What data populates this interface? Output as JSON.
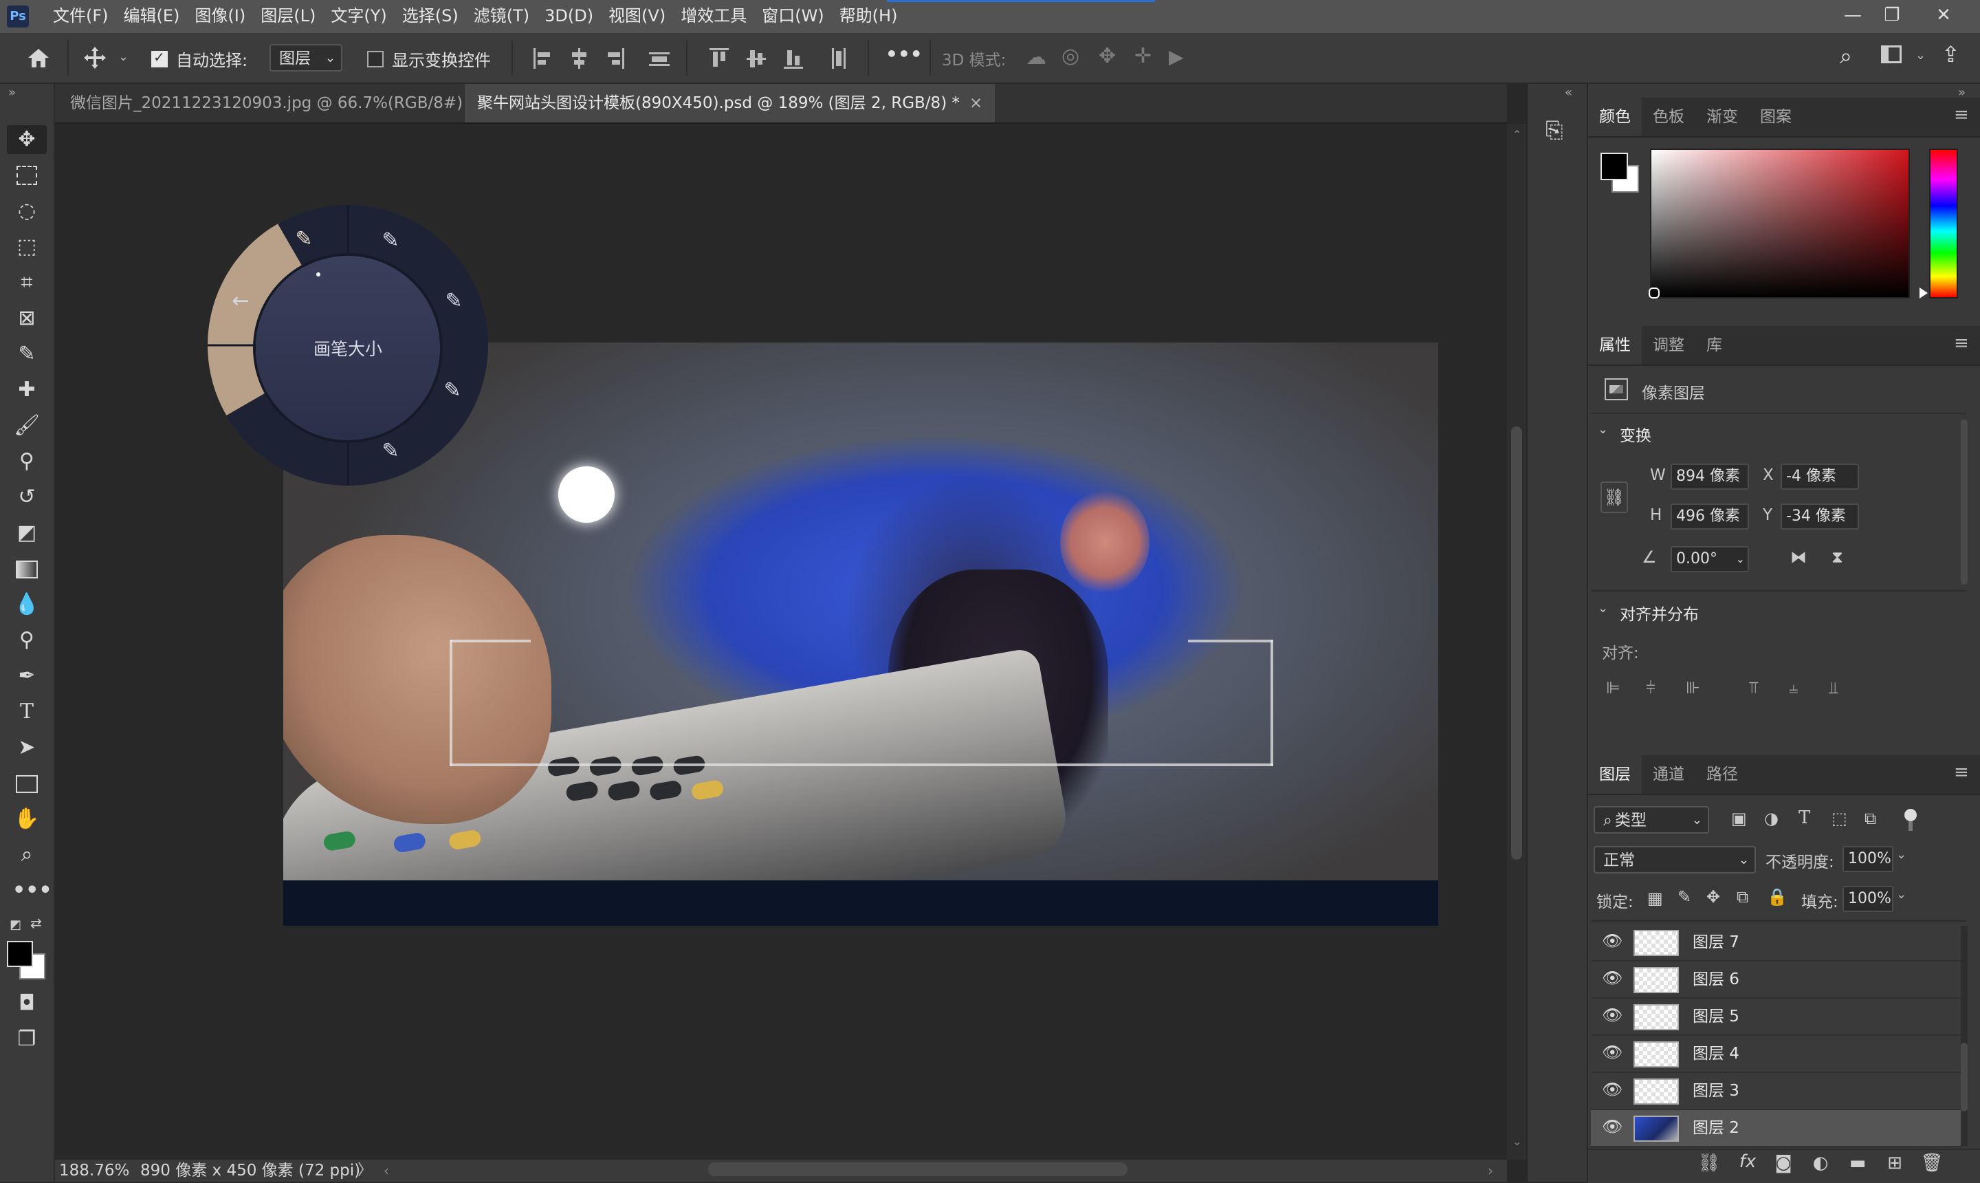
{
  "app": {
    "logo": "Ps",
    "menu": [
      "文件(F)",
      "编辑(E)",
      "图像(I)",
      "图层(L)",
      "文字(Y)",
      "选择(S)",
      "滤镜(T)",
      "3D(D)",
      "视图(V)",
      "增效工具",
      "窗口(W)",
      "帮助(H)"
    ],
    "window_controls": [
      "—",
      "❐",
      "✕"
    ]
  },
  "options_bar": {
    "home_icon": "home-icon",
    "move_icon": "move-icon",
    "auto_select_label": "自动选择:",
    "auto_select_checked": true,
    "auto_select_target": "图层",
    "show_transform_label": "显示变换控件",
    "show_transform_checked": false,
    "more": "•••",
    "mode_3d_label": "3D 模式:"
  },
  "tabs": [
    {
      "label": "微信图片_20211223120903.jpg @ 66.7%(RGB/8#)",
      "close": "×",
      "active": false
    },
    {
      "label": "聚牛网站头图设计模板(890X450).psd @ 189% (图层 2, RGB/8) *",
      "close": "×",
      "active": true
    }
  ],
  "tools": [
    "move-icon",
    "marquee-icon",
    "lasso-icon",
    "object-select-icon",
    "crop-icon",
    "frame-icon",
    "eyedropper-icon",
    "healing-icon",
    "brush-icon",
    "stamp-icon",
    "history-brush-icon",
    "eraser-icon",
    "gradient-icon",
    "blur-icon",
    "dodge-icon",
    "pen-icon",
    "type-icon",
    "path-select-icon",
    "rectangle-icon",
    "hand-icon",
    "zoom-icon",
    "more-tools-icon"
  ],
  "radial_menu": {
    "label": "画笔大小",
    "back_icon": "←"
  },
  "status": {
    "zoom": "188.76%",
    "doc_info": "890 像素 x 450 像素 (72 ppi)",
    "arrow": "〉"
  },
  "color_panel": {
    "tabs": [
      "颜色",
      "色板",
      "渐变",
      "图案"
    ],
    "foreground": "#000000",
    "background": "#ffffff"
  },
  "properties_panel": {
    "tabs": [
      "属性",
      "调整",
      "库"
    ],
    "layer_type": "像素图层",
    "transform_title": "变换",
    "w_label": "W",
    "w_value": "894 像素",
    "h_label": "H",
    "h_value": "496 像素",
    "x_label": "X",
    "x_value": "-4 像素",
    "y_label": "Y",
    "y_value": "-34 像素",
    "angle_value": "0.00°",
    "align_title": "对齐并分布",
    "align_label": "对齐:"
  },
  "layers_panel": {
    "tabs": [
      "图层",
      "通道",
      "路径"
    ],
    "filter_kind": "类型",
    "blend_mode": "正常",
    "opacity_label": "不透明度:",
    "opacity_value": "100%",
    "lock_label": "锁定:",
    "fill_label": "填充:",
    "fill_value": "100%",
    "layers": [
      {
        "name": "图层 7",
        "selected": false,
        "thumb": "transparent"
      },
      {
        "name": "图层 6",
        "selected": false,
        "thumb": "transparent"
      },
      {
        "name": "图层 5",
        "selected": false,
        "thumb": "transparent"
      },
      {
        "name": "图层 4",
        "selected": false,
        "thumb": "transparent"
      },
      {
        "name": "图层 3",
        "selected": false,
        "thumb": "transparent"
      },
      {
        "name": "图层 2",
        "selected": true,
        "thumb": "image"
      }
    ]
  }
}
